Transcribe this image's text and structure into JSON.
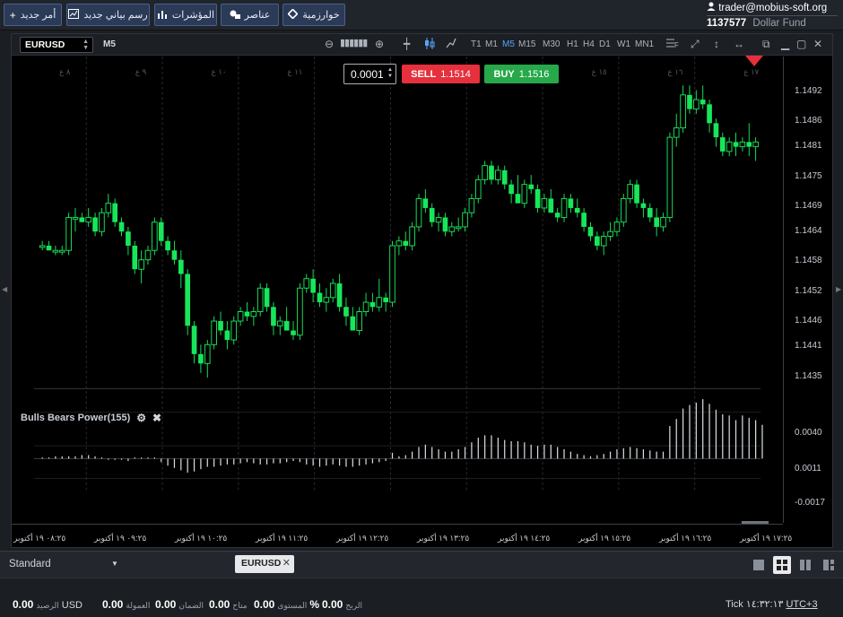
{
  "toolbar": {
    "new_order": "أمر جديد",
    "new_chart": "رسم بياني جديد",
    "indicators": "المؤشرات",
    "elements": "عناصر",
    "algorithms": "خوارزمية"
  },
  "account": {
    "email": "trader@mobius-soft.org",
    "id": "1137577",
    "name": "Dollar Fund"
  },
  "chart": {
    "symbol": "EURUSD",
    "timeframe": "M5",
    "timeframes": [
      "T1",
      "M1",
      "M5",
      "M15",
      "M30",
      "H1",
      "H4",
      "D1",
      "W1",
      "MN1"
    ],
    "active_timeframe": "M5",
    "lot": "0.0001",
    "sell_label": "SELL",
    "sell_price": "1.1514",
    "buy_label": "BUY",
    "buy_price": "1.1516",
    "price_labels": [
      "1.1492",
      "1.1486",
      "1.1481",
      "1.1475",
      "1.1469",
      "1.1464",
      "1.1458",
      "1.1452",
      "1.1446",
      "1.1441",
      "1.1435"
    ],
    "indicator_name": "Bulls Bears Power(155)",
    "indicator_labels": [
      "0.0040",
      "0.0011",
      "-0.0017"
    ],
    "time_labels": [
      "٠٨:٢٥ ١٩ أكتوبر",
      "٠٩:٢٥ ١٩ أكتوبر",
      "١٠:٢٥ ١٩ أكتوبر",
      "١١:٢٥ ١٩ أكتوبر",
      "١٢:٢٥ ١٩ أكتوبر",
      "١٣:٢٥ ١٩ أكتوبر",
      "١٤:٢٥ ١٩ أكتوبر",
      "١٥:٢٥ ١٩ أكتوبر",
      "١٦:٢٥ ١٩ أكتوبر",
      "١٧:٢٥ ١٩ أكتوبر"
    ],
    "hour_markers": [
      "٨ ع",
      "٩ ع",
      "١٠ ع",
      "١١ ع",
      "١٢ ع",
      "١٣ ع",
      "١٤ ع",
      "١٥ ع",
      "١٦ ع",
      "١٧ ع"
    ],
    "bull_color": "#18e65a",
    "bear_color": "#18e65a"
  },
  "chart_data": {
    "type": "candlestick",
    "y_range": [
      1.1431,
      1.1497
    ],
    "candles": [
      [
        1.1459,
        1.146,
        1.1458,
        1.1459
      ],
      [
        1.1459,
        1.146,
        1.1458,
        1.1458
      ],
      [
        1.1458,
        1.1459,
        1.1457,
        1.1458
      ],
      [
        1.1458,
        1.1459,
        1.1457,
        1.1458
      ],
      [
        1.1458,
        1.1466,
        1.1457,
        1.1465
      ],
      [
        1.1465,
        1.1467,
        1.1462,
        1.1465
      ],
      [
        1.1465,
        1.1466,
        1.1464,
        1.1464
      ],
      [
        1.1464,
        1.1467,
        1.1463,
        1.1465
      ],
      [
        1.1465,
        1.1466,
        1.1461,
        1.1462
      ],
      [
        1.1462,
        1.1467,
        1.1461,
        1.1466
      ],
      [
        1.1466,
        1.147,
        1.1465,
        1.1468
      ],
      [
        1.1468,
        1.1469,
        1.1463,
        1.1464
      ],
      [
        1.1464,
        1.1465,
        1.1461,
        1.1462
      ],
      [
        1.1462,
        1.1463,
        1.1457,
        1.1459
      ],
      [
        1.1459,
        1.146,
        1.1453,
        1.1454
      ],
      [
        1.1454,
        1.1458,
        1.1451,
        1.1456
      ],
      [
        1.1456,
        1.1459,
        1.1455,
        1.1458
      ],
      [
        1.1458,
        1.1465,
        1.1457,
        1.1464
      ],
      [
        1.1464,
        1.1465,
        1.1459,
        1.146
      ],
      [
        1.146,
        1.1461,
        1.1457,
        1.1458
      ],
      [
        1.1458,
        1.146,
        1.1455,
        1.1456
      ],
      [
        1.1456,
        1.1458,
        1.145,
        1.1453
      ],
      [
        1.1453,
        1.1454,
        1.144,
        1.1442
      ],
      [
        1.1442,
        1.1443,
        1.1434,
        1.1436
      ],
      [
        1.1436,
        1.1438,
        1.1432,
        1.1434
      ],
      [
        1.1434,
        1.1439,
        1.1431,
        1.1438
      ],
      [
        1.1438,
        1.1444,
        1.1437,
        1.1443
      ],
      [
        1.1443,
        1.1445,
        1.144,
        1.1441
      ],
      [
        1.1441,
        1.1443,
        1.1437,
        1.1439
      ],
      [
        1.1439,
        1.1444,
        1.1438,
        1.1443
      ],
      [
        1.1443,
        1.1446,
        1.1442,
        1.1445
      ],
      [
        1.1445,
        1.1447,
        1.1443,
        1.1444
      ],
      [
        1.1444,
        1.1446,
        1.1442,
        1.1445
      ],
      [
        1.1445,
        1.1451,
        1.1444,
        1.145
      ],
      [
        1.145,
        1.1451,
        1.1445,
        1.1446
      ],
      [
        1.1446,
        1.1447,
        1.144,
        1.1442
      ],
      [
        1.1442,
        1.1444,
        1.144,
        1.1443
      ],
      [
        1.1443,
        1.1446,
        1.1442,
        1.1441
      ],
      [
        1.1441,
        1.1443,
        1.1439,
        1.144
      ],
      [
        1.144,
        1.1451,
        1.1439,
        1.145
      ],
      [
        1.145,
        1.1453,
        1.1449,
        1.1452
      ],
      [
        1.1452,
        1.1454,
        1.1447,
        1.1449
      ],
      [
        1.1449,
        1.1451,
        1.1446,
        1.1447
      ],
      [
        1.1447,
        1.145,
        1.1445,
        1.1448
      ],
      [
        1.1448,
        1.1452,
        1.1447,
        1.1451
      ],
      [
        1.1451,
        1.1453,
        1.1445,
        1.1446
      ],
      [
        1.1446,
        1.1448,
        1.1442,
        1.1444
      ],
      [
        1.1444,
        1.1446,
        1.1442,
        1.1441
      ],
      [
        1.1441,
        1.1446,
        1.144,
        1.1445
      ],
      [
        1.1445,
        1.1449,
        1.1444,
        1.1447
      ],
      [
        1.1447,
        1.1449,
        1.1445,
        1.1446
      ],
      [
        1.1446,
        1.1452,
        1.1445,
        1.1448
      ],
      [
        1.1448,
        1.1449,
        1.1445,
        1.1447
      ],
      [
        1.1447,
        1.146,
        1.1446,
        1.1459
      ],
      [
        1.1459,
        1.1461,
        1.1457,
        1.146
      ],
      [
        1.146,
        1.1462,
        1.1458,
        1.1459
      ],
      [
        1.1459,
        1.1464,
        1.1458,
        1.1463
      ],
      [
        1.1463,
        1.147,
        1.1462,
        1.1469
      ],
      [
        1.1469,
        1.1471,
        1.1466,
        1.1467
      ],
      [
        1.1467,
        1.1468,
        1.1463,
        1.1464
      ],
      [
        1.1464,
        1.1466,
        1.1462,
        1.1465
      ],
      [
        1.1465,
        1.1466,
        1.1461,
        1.1462
      ],
      [
        1.1462,
        1.1464,
        1.1461,
        1.1463
      ],
      [
        1.1463,
        1.1465,
        1.1462,
        1.1463
      ],
      [
        1.1463,
        1.1467,
        1.1462,
        1.1466
      ],
      [
        1.1466,
        1.147,
        1.1465,
        1.1469
      ],
      [
        1.1469,
        1.1474,
        1.1468,
        1.1473
      ],
      [
        1.1473,
        1.1477,
        1.1472,
        1.1476
      ],
      [
        1.1476,
        1.1477,
        1.1472,
        1.1473
      ],
      [
        1.1473,
        1.1476,
        1.1472,
        1.1475
      ],
      [
        1.1475,
        1.1476,
        1.1471,
        1.1472
      ],
      [
        1.1472,
        1.1473,
        1.1468,
        1.147
      ],
      [
        1.147,
        1.1474,
        1.1469,
        1.1468
      ],
      [
        1.1468,
        1.1473,
        1.1467,
        1.1472
      ],
      [
        1.1472,
        1.1474,
        1.147,
        1.1471
      ],
      [
        1.1471,
        1.1472,
        1.1466,
        1.1467
      ],
      [
        1.1467,
        1.147,
        1.1466,
        1.1469
      ],
      [
        1.1469,
        1.1471,
        1.1466,
        1.1466
      ],
      [
        1.1466,
        1.1467,
        1.1464,
        1.1465
      ],
      [
        1.1465,
        1.147,
        1.1464,
        1.1469
      ],
      [
        1.1469,
        1.147,
        1.1466,
        1.1467
      ],
      [
        1.1467,
        1.1469,
        1.1465,
        1.1466
      ],
      [
        1.1466,
        1.1467,
        1.1462,
        1.1463
      ],
      [
        1.1463,
        1.1464,
        1.146,
        1.1461
      ],
      [
        1.1461,
        1.1462,
        1.1458,
        1.1459
      ],
      [
        1.1459,
        1.1462,
        1.1457,
        1.1461
      ],
      [
        1.1461,
        1.1464,
        1.146,
        1.1462
      ],
      [
        1.1462,
        1.1465,
        1.1461,
        1.1464
      ],
      [
        1.1464,
        1.147,
        1.1463,
        1.1469
      ],
      [
        1.1469,
        1.1473,
        1.1468,
        1.1472
      ],
      [
        1.1472,
        1.1473,
        1.1467,
        1.1468
      ],
      [
        1.1468,
        1.1469,
        1.1465,
        1.1467
      ],
      [
        1.1467,
        1.1468,
        1.1464,
        1.1465
      ],
      [
        1.1465,
        1.1467,
        1.1461,
        1.1463
      ],
      [
        1.1463,
        1.1466,
        1.1462,
        1.1465
      ],
      [
        1.1465,
        1.1483,
        1.1464,
        1.1482
      ],
      [
        1.1482,
        1.1487,
        1.148,
        1.1484
      ],
      [
        1.1484,
        1.1493,
        1.1483,
        1.1491
      ],
      [
        1.1491,
        1.1493,
        1.1487,
        1.1488
      ],
      [
        1.1488,
        1.1492,
        1.1487,
        1.149
      ],
      [
        1.149,
        1.1493,
        1.1488,
        1.1489
      ],
      [
        1.1489,
        1.149,
        1.1483,
        1.1485
      ],
      [
        1.1485,
        1.1486,
        1.148,
        1.1482
      ],
      [
        1.1482,
        1.1483,
        1.1478,
        1.1479
      ],
      [
        1.1479,
        1.1482,
        1.1478,
        1.1481
      ],
      [
        1.1481,
        1.1483,
        1.1478,
        1.148
      ],
      [
        1.148,
        1.1482,
        1.1479,
        1.1481
      ],
      [
        1.1481,
        1.1485,
        1.1478,
        1.148
      ],
      [
        1.148,
        1.1482,
        1.1477,
        1.1481
      ]
    ],
    "indicator_values": [
      0.0001,
      0.0001,
      0.0002,
      0.0002,
      0.0002,
      0.0002,
      0.0003,
      0.0003,
      0.0002,
      0.0001,
      -0.0001,
      -0.0001,
      -0.0001,
      -0.0002,
      0.0001,
      0.0001,
      0.0001,
      0.0001,
      -0.0003,
      -0.0006,
      -0.0008,
      -0.001,
      -0.0012,
      -0.0011,
      -0.0009,
      -0.0007,
      -0.0007,
      -0.0006,
      -0.0005,
      -0.0005,
      -0.0004,
      -0.0003,
      -0.0004,
      -0.0005,
      -0.0005,
      -0.0004,
      -0.0004,
      -0.0003,
      -0.0002,
      -0.0003,
      -0.0005,
      -0.0006,
      -0.0007,
      -0.0006,
      -0.0005,
      -0.0006,
      -0.0007,
      -0.0007,
      -0.0006,
      -0.0005,
      -0.0004,
      -0.0003,
      -0.0002,
      0.0005,
      0.0002,
      0.0003,
      0.0006,
      0.001,
      0.0012,
      0.001,
      0.0008,
      0.0006,
      0.0006,
      0.0008,
      0.001,
      0.0014,
      0.0018,
      0.002,
      0.002,
      0.0018,
      0.0016,
      0.0015,
      0.0015,
      0.0014,
      0.0012,
      0.0011,
      0.0012,
      0.0012,
      0.001,
      0.0008,
      0.0006,
      0.0004,
      0.0003,
      0.0002,
      0.0003,
      0.0004,
      0.0006,
      0.0008,
      0.0009,
      0.001,
      0.0009,
      0.0008,
      0.0007,
      0.0006,
      0.0006,
      0.0028,
      0.0034,
      0.0043,
      0.0046,
      0.0048,
      0.0051,
      0.0047,
      0.0042,
      0.0038,
      0.0037,
      0.0033,
      0.0037,
      0.0035,
      0.0033,
      0.0029
    ],
    "indicator_range": [
      -0.0032,
      0.0055
    ]
  },
  "tabs": {
    "layout_name": "Standard",
    "open_tab": "EURUSD"
  },
  "status": {
    "balance_label": "الرصيد",
    "balance_value": "0.00",
    "currency": "USD",
    "equity_label": "العمولة",
    "equity_value": "0.00",
    "margin_label": "الضمان",
    "margin_value": "0.00",
    "free_label": "متاح",
    "free_value": "0.00",
    "level_label": "المستوى",
    "level_value": "%",
    "profit_label": "الربح",
    "profit_value": "0.00",
    "mode": "Tick",
    "clock": "١٤:٣٢:١٣",
    "timezone": "UTC+3"
  }
}
